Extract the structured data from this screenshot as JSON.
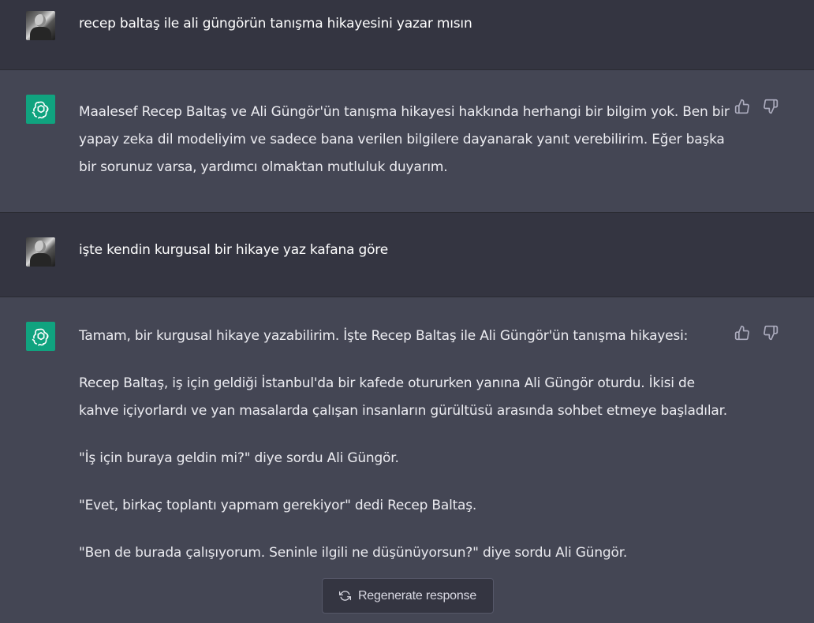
{
  "messages": [
    {
      "role": "user",
      "text": "recep baltaş ile ali güngörün tanışma hikayesini yazar mısın"
    },
    {
      "role": "assistant",
      "paragraphs": [
        "Maalesef Recep Baltaş ve Ali Güngör'ün tanışma hikayesi hakkında herhangi bir bilgim yok. Ben bir yapay zeka dil modeliyim ve sadece bana verilen bilgilere dayanarak yanıt verebilirim. Eğer başka bir sorunuz varsa, yardımcı olmaktan mutluluk duyarım."
      ]
    },
    {
      "role": "user",
      "text": "işte kendin kurgusal bir hikaye yaz kafana göre"
    },
    {
      "role": "assistant",
      "paragraphs": [
        "Tamam, bir kurgusal hikaye yazabilirim. İşte Recep Baltaş ile Ali Güngör'ün tanışma hikayesi:",
        "Recep Baltaş, iş için geldiği İstanbul'da bir kafede otururken yanına Ali Güngör oturdu. İkisi de kahve içiyorlardı ve yan masalarda çalışan insanların gürültüsü arasında sohbet etmeye başladılar.",
        "\"İş için buraya geldin mi?\" diye sordu Ali Güngör.",
        "\"Evet, birkaç toplantı yapmam gerekiyor\" dedi Recep Baltaş.",
        "\"Ben de burada çalışıyorum. Seninle ilgili ne düşünüyorsun?\" diye sordu Ali Güngör."
      ]
    }
  ],
  "regenerate": {
    "label": "Regenerate response",
    "icon": "refresh-icon"
  },
  "colors": {
    "user_bg": "#343541",
    "assistant_bg": "#444654",
    "bot_avatar": "#10a37f",
    "text": "#ececf1"
  }
}
